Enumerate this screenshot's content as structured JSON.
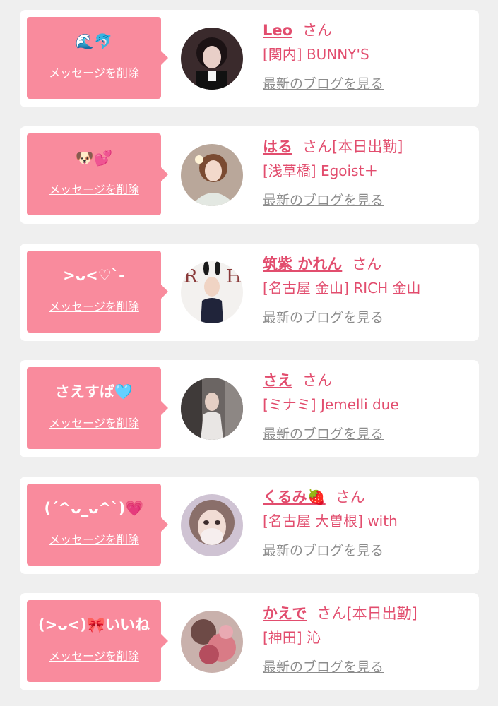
{
  "colors": {
    "page_background": "#efefef",
    "card_background": "#ffffff",
    "message_box": "#f98b9d",
    "accent_text": "#e24d6e",
    "link_gray": "#8c8c8c"
  },
  "cards": [
    {
      "message": "🌊🐬",
      "delete_label": "メッセージを削除",
      "name": "Leo",
      "honorific": "さん",
      "status": "",
      "shop": "[関内] BUNNY'S",
      "blog_link": "最新のブログを見る",
      "avatar_icon": "profile-photo"
    },
    {
      "message": "🐶💕",
      "delete_label": "メッセージを削除",
      "name": "はる",
      "honorific": "さん",
      "status": "[本日出勤]",
      "shop": "[浅草橋] Egoist＋",
      "blog_link": "最新のブログを見る",
      "avatar_icon": "profile-photo"
    },
    {
      "message": ">ᴗ<♡`-",
      "delete_label": "メッセージを削除",
      "name": "筑紫 かれん",
      "honorific": "さん",
      "status": "",
      "shop": "[名古屋 金山] RICH 金山",
      "blog_link": "最新のブログを見る",
      "avatar_icon": "profile-photo"
    },
    {
      "message": "さえすば🩵",
      "delete_label": "メッセージを削除",
      "name": "さえ",
      "honorific": "さん",
      "status": "",
      "shop": "[ミナミ] Jemelli due",
      "blog_link": "最新のブログを見る",
      "avatar_icon": "profile-photo"
    },
    {
      "message": "(ˊ^ᴗ_ᴗ^ˋ)💗",
      "delete_label": "メッセージを削除",
      "name": "くるみ🍓",
      "honorific": "さん",
      "status": "",
      "shop": "[名古屋 大曽根] with",
      "blog_link": "最新のブログを見る",
      "avatar_icon": "profile-photo"
    },
    {
      "message": "(>ᴗ<)🎀いいね",
      "delete_label": "メッセージを削除",
      "name": "かえで",
      "honorific": "さん",
      "status": "[本日出勤]",
      "shop": "[神田] 沁",
      "blog_link": "最新のブログを見る",
      "avatar_icon": "profile-photo"
    }
  ]
}
